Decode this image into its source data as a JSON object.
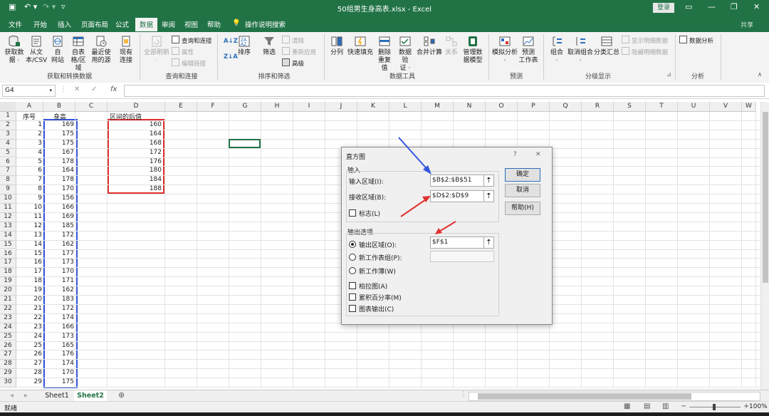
{
  "window": {
    "title": "50组男生身高表.xlsx  -  Excel",
    "login_label": "登录",
    "share_label": "共享"
  },
  "tabs": [
    "文件",
    "开始",
    "插入",
    "页面布局",
    "公式",
    "数据",
    "审阅",
    "视图",
    "帮助",
    "操作说明搜索"
  ],
  "ribbon": {
    "get_data": {
      "label1": "获取数",
      "label2": "据 ·"
    },
    "from_text": {
      "label1": "从文",
      "label2": "本/CSV"
    },
    "from_web": {
      "label1": "自",
      "label2": "网站"
    },
    "from_table": {
      "label1": "自表",
      "label2": "格/区域"
    },
    "recent_sources": {
      "label1": "最近使",
      "label2": "用的源"
    },
    "existing": {
      "label1": "现有",
      "label2": "连接"
    },
    "refresh_all": {
      "label1": "全部刷新",
      "label2": "·"
    },
    "query_connections": "查询和连接",
    "properties": "属性",
    "edit_links": "编辑链接",
    "sort": "排序",
    "filter": "筛选",
    "clear": "清除",
    "reapply": "重新应用",
    "advanced": "高级",
    "split": "分列",
    "flash_fill": "快速填充",
    "remove_dup": {
      "label1": "删除",
      "label2": "重复值"
    },
    "validate": {
      "label1": "数据验",
      "label2": "证 ·"
    },
    "consolidate": "合并计算",
    "relations": "关系",
    "manage_model": {
      "label1": "管理数",
      "label2": "据模型"
    },
    "what_if": {
      "label1": "模拟分析",
      "label2": "·"
    },
    "forecast_sheet": {
      "label1": "预测",
      "label2": "工作表"
    },
    "group": {
      "label1": "组合",
      "label2": "·"
    },
    "ungroup": {
      "label1": "取消组合",
      "label2": "·"
    },
    "subtotal": "分类汇总",
    "show_detail": "显示明细数据",
    "hide_detail": "隐藏明细数据",
    "data_analysis": "数据分析",
    "groups": {
      "get_transform": "获取和转换数据",
      "queries": "查询和连接",
      "sort_filter": "排序和筛选",
      "data_tools": "数据工具",
      "forecast": "预测",
      "outline": "分级显示",
      "analysis": "分析"
    }
  },
  "formula_bar": {
    "name_box": "G4",
    "fx": "fx",
    "formula": ""
  },
  "columns": [
    "A",
    "B",
    "C",
    "D",
    "E",
    "F",
    "G",
    "H",
    "I",
    "J",
    "K",
    "L",
    "M",
    "N",
    "O",
    "P",
    "Q",
    "R",
    "S",
    "T",
    "U",
    "V",
    "W"
  ],
  "header_row": {
    "a": "序号",
    "b": "身高",
    "d": "区间的后值"
  },
  "heights": [
    169,
    175,
    175,
    167,
    178,
    164,
    178,
    170,
    156,
    166,
    169,
    185,
    172,
    162,
    177,
    173,
    170,
    171,
    162,
    183,
    172,
    174,
    166,
    173,
    165,
    176,
    174,
    170,
    175
  ],
  "bins": [
    160,
    164,
    168,
    172,
    176,
    180,
    184,
    188
  ],
  "sheets": {
    "s1": "Sheet1",
    "s2": "Sheet2"
  },
  "status": {
    "ready": "就绪",
    "zoom": "100%"
  },
  "dialog": {
    "title": "直方图",
    "help": "?",
    "close": "✕",
    "input_section": "输入",
    "input_range_label": "输入区域(I):",
    "input_range_value": "$B$2:$B$51",
    "bin_range_label": "接收区域(B):",
    "bin_range_value": "$D$2:$D$9",
    "labels_option": "标志(L)",
    "output_section": "输出选项",
    "output_range_label": "输出区域(O):",
    "output_range_value": "$F$1",
    "new_sheet_label": "新工作表组(P):",
    "new_workbook_label": "新工作薄(W)",
    "pareto_label": "柏拉图(A)",
    "cumulative_label": "累积百分率(M)",
    "chart_label": "图表输出(C)",
    "ok": "确定",
    "cancel": "取消",
    "help_btn": "帮助(H)"
  },
  "colors": {
    "excel_green": "#217346",
    "highlight_blue": "#3355dd",
    "highlight_red": "#e03030"
  }
}
